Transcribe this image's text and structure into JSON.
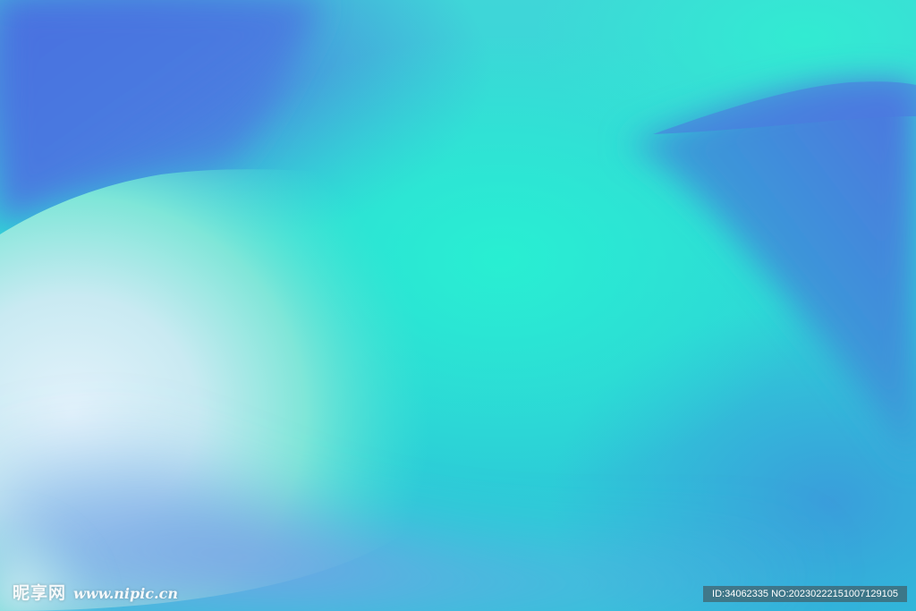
{
  "image": {
    "description_colors": {
      "deep_blue": "#4a72e0",
      "cyan": "#2ee6d8",
      "teal_blue": "#2bb8dc",
      "pale_highlight": "#dff1f8"
    }
  },
  "watermark": {
    "brand": "昵享网",
    "url": "www.nipic.cn",
    "id_text": "ID:34062335 NO:20230222151007129105"
  }
}
